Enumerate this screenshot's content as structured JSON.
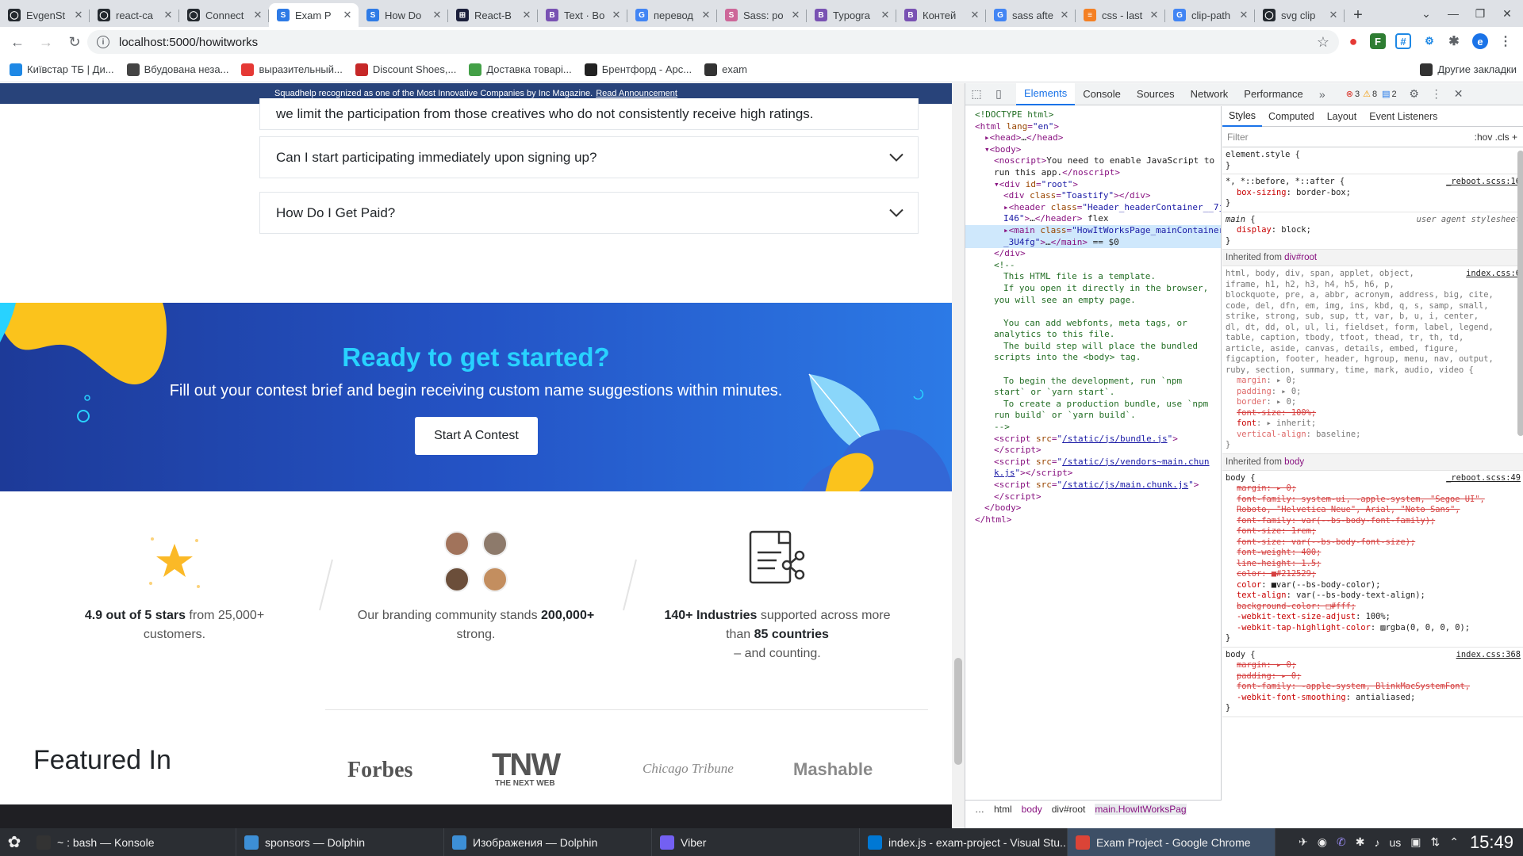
{
  "browser": {
    "tabs": [
      {
        "title": "EvgenSt",
        "color": "#24292f",
        "glyph": "◯"
      },
      {
        "title": "react-ca",
        "color": "#24292f",
        "glyph": "◯"
      },
      {
        "title": "Connect",
        "color": "#24292f",
        "glyph": "◯"
      },
      {
        "title": "Exam P",
        "color": "#2e7be6",
        "glyph": "S"
      },
      {
        "title": "How Do",
        "color": "#2e7be6",
        "glyph": "S"
      },
      {
        "title": "React-B",
        "color": "#1b1f3b",
        "glyph": "⊞"
      },
      {
        "title": "Text · Bo",
        "color": "#7952b3",
        "glyph": "B"
      },
      {
        "title": "перевод",
        "color": "#4285f4",
        "glyph": "G"
      },
      {
        "title": "Sass: po",
        "color": "#cd6799",
        "glyph": "S"
      },
      {
        "title": "Typogra",
        "color": "#7952b3",
        "glyph": "B"
      },
      {
        "title": "Контей",
        "color": "#7952b3",
        "glyph": "B"
      },
      {
        "title": "sass afte",
        "color": "#4285f4",
        "glyph": "G"
      },
      {
        "title": "css - last",
        "color": "#f48024",
        "glyph": "≡"
      },
      {
        "title": "clip-path",
        "color": "#4285f4",
        "glyph": "G"
      },
      {
        "title": "svg clip",
        "color": "#24292f",
        "glyph": "◯"
      }
    ],
    "active_tab_index": 3,
    "url": "localhost:5000/howitworks",
    "bookmarks": [
      {
        "label": "Київстар ТБ | Ди...",
        "color": "#1e88e5"
      },
      {
        "label": "Вбудована неза...",
        "color": "#444"
      },
      {
        "label": "выразительный...",
        "color": "#e53935"
      },
      {
        "label": "Discount Shoes,...",
        "color": "#c62828"
      },
      {
        "label": "Доставка товарі...",
        "color": "#43a047"
      },
      {
        "label": "Брентфорд - Арс...",
        "color": "#222"
      },
      {
        "label": "exam",
        "color": "#333"
      }
    ],
    "other_bookmarks": "Другие закладки",
    "profile_initial": "e"
  },
  "page": {
    "announcement": "Squadhelp recognized as one of the Most Innovative Companies by Inc Magazine.",
    "announcement_link": "Read Announcement",
    "faq_partial": "we limit the participation from those creatives who do not consistently receive high ratings.",
    "faqs": [
      {
        "question": "Can I start participating immediately upon signing up?"
      },
      {
        "question": "How Do I Get Paid?"
      }
    ],
    "cta": {
      "title": "Ready to get started?",
      "subtitle": "Fill out your contest brief and begin receiving custom name suggestions within minutes.",
      "button": "Start A Contest"
    },
    "stats": [
      {
        "bold": "4.9 out of 5 stars",
        "rest": " from 25,000+ customers."
      },
      {
        "pre": "Our branding community stands ",
        "bold": "200,000+",
        "rest": " strong."
      },
      {
        "bold": "140+ Industries",
        "mid": " supported across more than ",
        "bold2": "85 countries",
        "rest": "– and counting."
      }
    ],
    "featured_title": "Featured In",
    "featured_logos": [
      "Forbes",
      "TNW",
      "THE NEXT WEB",
      "Chicago Tribune",
      "Mashable"
    ]
  },
  "devtools": {
    "tabs": [
      "Elements",
      "Console",
      "Sources",
      "Network",
      "Performance"
    ],
    "active_tab": "Elements",
    "badges": {
      "errors": "3",
      "warnings": "8",
      "messages": "2"
    },
    "style_tabs": [
      "Styles",
      "Computed",
      "Layout",
      "Event Listeners"
    ],
    "filter_placeholder": "Filter",
    "filter_tools": ":hov  .cls  +",
    "breadcrumbs": [
      "html",
      "body",
      "div#root",
      "main.HowItWorksPag"
    ],
    "dom_lines": [
      {
        "indent": 0,
        "html": "<span class='c'>&lt;!DOCTYPE html&gt;</span>"
      },
      {
        "indent": 0,
        "html": "<span class='t'>&lt;html</span> <span class='a'>lang</span>=<span class='v'>\"en\"</span><span class='t'>&gt;</span>"
      },
      {
        "indent": 1,
        "html": "▸<span class='t'>&lt;head&gt;</span><span class='tx'>…</span><span class='t'>&lt;/head&gt;</span>"
      },
      {
        "indent": 1,
        "html": "▾<span class='t'>&lt;body&gt;</span>"
      },
      {
        "indent": 2,
        "html": "<span class='t'>&lt;noscript&gt;</span><span class='tx'>You need to enable JavaScript to</span>"
      },
      {
        "indent": 2,
        "html": "<span class='tx'>run this app.</span><span class='t'>&lt;/noscript&gt;</span>"
      },
      {
        "indent": 2,
        "html": "▾<span class='t'>&lt;div</span> <span class='a'>id</span>=<span class='v'>\"root\"</span><span class='t'>&gt;</span>"
      },
      {
        "indent": 3,
        "html": "<span class='t'>&lt;div</span> <span class='a'>class</span>=<span class='v'>\"Toastify\"</span><span class='t'>&gt;&lt;/div&gt;</span>"
      },
      {
        "indent": 3,
        "html": "▸<span class='t'>&lt;header</span> <span class='a'>class</span>=<span class='v'>\"Header_headerContainer__7j</span>"
      },
      {
        "indent": 3,
        "html": "<span class='v'>I46\"</span><span class='t'>&gt;</span><span class='tx'>…</span><span class='t'>&lt;/header&gt;</span> <span class='tx'>flex</span>"
      },
      {
        "indent": 3,
        "html": "▸<span class='t'>&lt;main</span> <span class='a'>class</span>=<span class='v'>\"HowItWorksPage_mainContainer</span>",
        "selected": true
      },
      {
        "indent": 3,
        "html": "<span class='v'>_3U4fg\"</span><span class='t'>&gt;</span><span class='tx'>…</span><span class='t'>&lt;/main&gt;</span> <span class='tx'>== $0</span>",
        "selected": true
      },
      {
        "indent": 2,
        "html": "<span class='t'>&lt;/div&gt;</span>"
      },
      {
        "indent": 2,
        "html": "<span class='c'>&lt;!--</span>"
      },
      {
        "indent": 3,
        "html": "<span class='c'>This HTML file is a template.</span>"
      },
      {
        "indent": 3,
        "html": "<span class='c'>If you open it directly in the browser,</span>"
      },
      {
        "indent": 2,
        "html": "<span class='c'>you will see an empty page.</span>"
      },
      {
        "indent": 2,
        "html": "&nbsp;"
      },
      {
        "indent": 3,
        "html": "<span class='c'>You can add webfonts, meta tags, or</span>"
      },
      {
        "indent": 2,
        "html": "<span class='c'>analytics to this file.</span>"
      },
      {
        "indent": 3,
        "html": "<span class='c'>The build step will place the bundled</span>"
      },
      {
        "indent": 2,
        "html": "<span class='c'>scripts into the &lt;body&gt; tag.</span>"
      },
      {
        "indent": 2,
        "html": "&nbsp;"
      },
      {
        "indent": 3,
        "html": "<span class='c'>To begin the development, run `npm</span>"
      },
      {
        "indent": 2,
        "html": "<span class='c'>start` or `yarn start`.</span>"
      },
      {
        "indent": 3,
        "html": "<span class='c'>To create a production bundle, use `npm</span>"
      },
      {
        "indent": 2,
        "html": "<span class='c'>run build` or `yarn build`.</span>"
      },
      {
        "indent": 2,
        "html": "<span class='c'>--&gt;</span>"
      },
      {
        "indent": 2,
        "html": "<span class='t'>&lt;script</span> <span class='a'>src</span>=<span class='v'>\"</span><span class='lk'>/static/js/bundle.js</span><span class='v'>\"</span><span class='t'>&gt;</span>"
      },
      {
        "indent": 2,
        "html": "<span class='t'>&lt;/script&gt;</span>"
      },
      {
        "indent": 2,
        "html": "<span class='t'>&lt;script</span> <span class='a'>src</span>=<span class='v'>\"</span><span class='lk'>/static/js/vendors~main.chun</span>"
      },
      {
        "indent": 2,
        "html": "<span class='lk'>k.js</span><span class='v'>\"</span><span class='t'>&gt;&lt;/script&gt;</span>"
      },
      {
        "indent": 2,
        "html": "<span class='t'>&lt;script</span> <span class='a'>src</span>=<span class='v'>\"</span><span class='lk'>/static/js/main.chunk.js</span><span class='v'>\"</span><span class='t'>&gt;</span>"
      },
      {
        "indent": 2,
        "html": "<span class='t'>&lt;/script&gt;</span>"
      },
      {
        "indent": 1,
        "html": "<span class='t'>&lt;/body&gt;</span>"
      },
      {
        "indent": 0,
        "html": "<span class='t'>&lt;/html&gt;</span>"
      }
    ],
    "inherited_root": "div#root",
    "inherited_body": "body"
  },
  "taskbar": {
    "tasks": [
      {
        "label": "~ : bash — Konsole",
        "color": "#333"
      },
      {
        "label": "sponsors — Dolphin",
        "color": "#3d8fd6"
      },
      {
        "label": "Изображения — Dolphin",
        "color": "#3d8fd6"
      },
      {
        "label": "Viber",
        "color": "#7360f2"
      },
      {
        "label": "index.js - exam-project - Visual Stu...",
        "color": "#0078d4"
      },
      {
        "label": "Exam Project - Google Chrome",
        "color": "#db4437",
        "active": true
      }
    ],
    "keyboard_layout": "us",
    "clock": "15:49"
  }
}
